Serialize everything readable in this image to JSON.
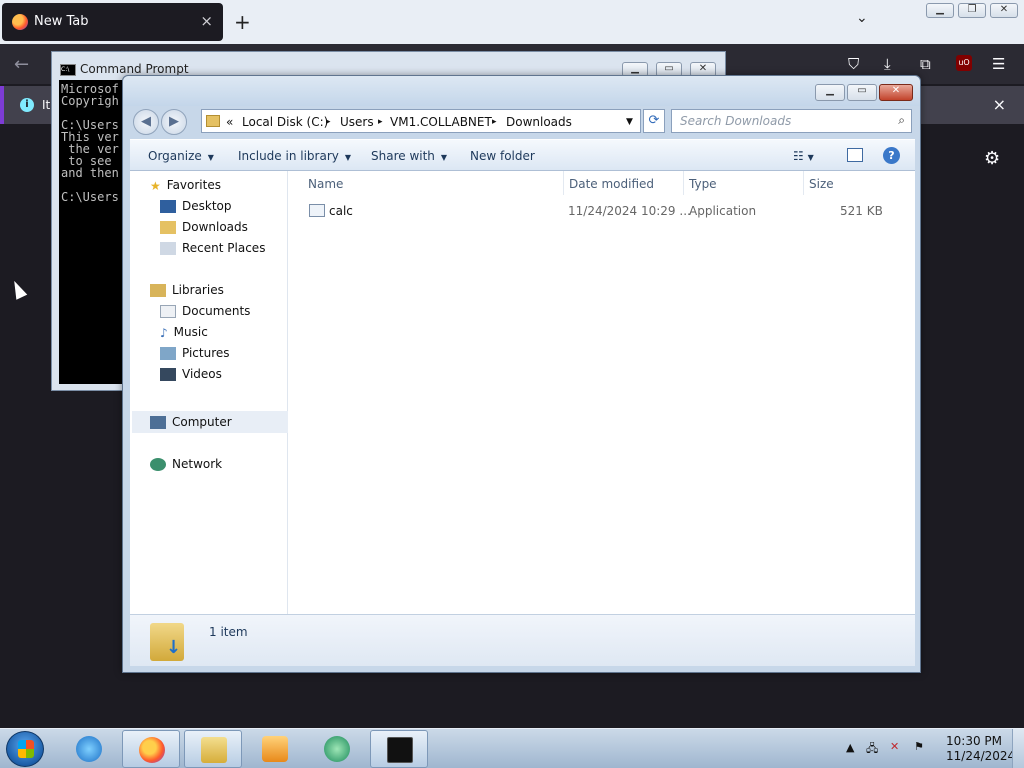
{
  "browser": {
    "tab_title": "New Tab",
    "tab_close": "×",
    "new_tab": "+",
    "notification_text": "It",
    "notification_close": "×"
  },
  "cmd": {
    "title": "Command Prompt",
    "lines": [
      "Microsof",
      "Copyrigh",
      "",
      "C:\\Users",
      "This ver",
      " the ver",
      " to see",
      "and then",
      "",
      "C:\\Users"
    ]
  },
  "explorer": {
    "address": [
      "«",
      "Local Disk (C:)",
      "▸",
      "Users",
      "▸",
      "VM1.COLLABNET",
      "▸",
      "Downloads"
    ],
    "search_placeholder": "Search Downloads",
    "commands": [
      "Organize",
      "Include in library",
      "Share with",
      "New folder"
    ],
    "nav": {
      "favorites": "Favorites",
      "desktop": "Desktop",
      "downloads": "Downloads",
      "recent": "Recent Places",
      "libraries": "Libraries",
      "documents": "Documents",
      "music": "Music",
      "pictures": "Pictures",
      "videos": "Videos",
      "computer": "Computer",
      "network": "Network"
    },
    "columns": [
      "Name",
      "Date modified",
      "Type",
      "Size"
    ],
    "file": {
      "name": "calc",
      "date": "11/24/2024 10:29 ...",
      "type": "Application",
      "size": "521 KB"
    },
    "status": "1 item"
  },
  "taskbar": {
    "time": "10:30 PM",
    "date": "11/24/2024"
  }
}
